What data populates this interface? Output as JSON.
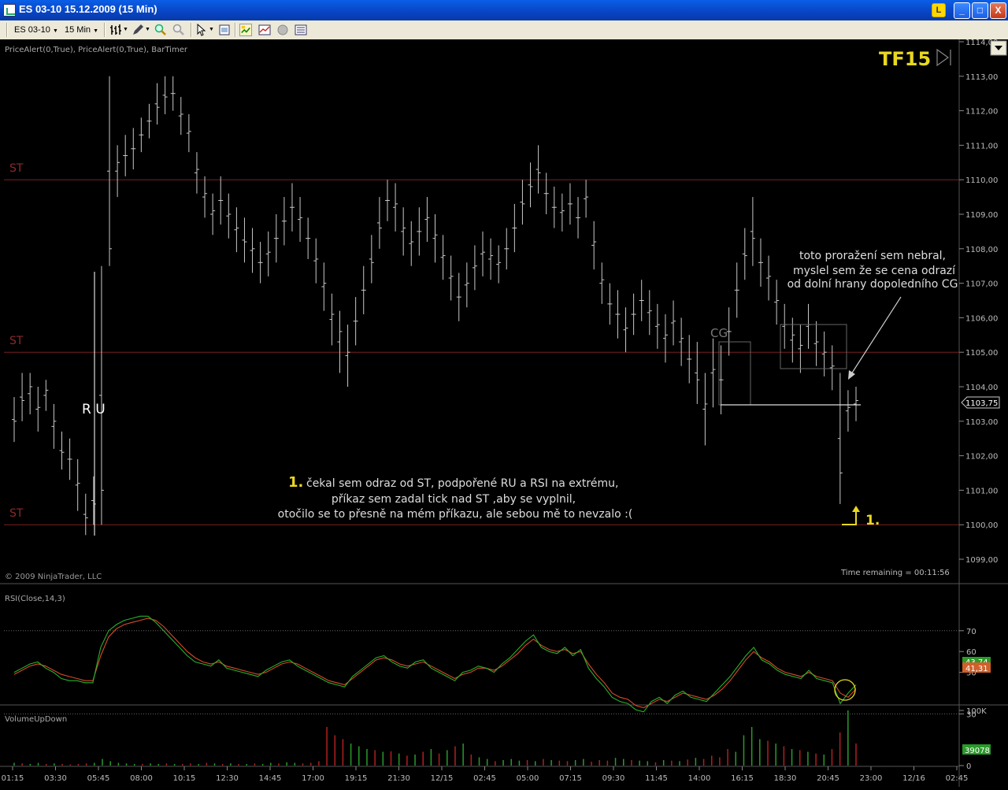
{
  "window": {
    "title": "ES 03-10  15.12.2009 (15 Min)",
    "l_badge": "L",
    "minimize": "_",
    "maximize": "□",
    "close": "X"
  },
  "toolbar": {
    "instrument": "ES 03-10",
    "interval": "15 Min"
  },
  "icons": [
    "chart-icon",
    "bars-icon",
    "pencil-icon",
    "zoom-in-icon",
    "zoom-out-icon",
    "cursor-icon",
    "properties-icon",
    "strategy-icon",
    "indicators-icon",
    "globe-icon",
    "data-box-icon"
  ],
  "colors": {
    "background": "#000000",
    "st_line": "#7a1f1f",
    "st_label": "#8b2a2a",
    "bars": "#c8c8c8",
    "annotation_yellow": "#e8d820",
    "rsi_red": "#d84a2a",
    "rsi_green": "#2ab02a",
    "vol_up": "#2a9a2a",
    "vol_down": "#b02020"
  },
  "price_panel": {
    "indicators_label": "PriceAlert(0,True), PriceAlert(0,True), BarTimer",
    "tf_label": "TF15",
    "copyright": "© 2009 NinjaTrader, LLC",
    "time_remaining": "Time remaining = 00:11:56",
    "current_price_label": "1103,75",
    "st_labels": [
      "ST",
      "ST",
      "ST"
    ],
    "ru_label": "R U",
    "cg_label": "CG",
    "note1_number": "1.",
    "note1_lines": [
      "čekal sem odraz od ST, podpořené RU a RSI na extrému,",
      "příkaz sem zadal tick nad ST ,aby se vyplnil,",
      "otočilo se to přesně na mém příkazu, ale sebou mě to nevzalo :("
    ],
    "note2_lines": [
      "toto proražení sem nebral,",
      "myslel sem že se cena odrazí",
      "od dolní hrany dopoledního CG"
    ],
    "marker_label": "1."
  },
  "rsi_panel": {
    "label": "RSI(Close,14,3)",
    "value_green": "43,74",
    "value_red": "41,31"
  },
  "volume_panel": {
    "label": "VolumeUpDown",
    "value": "39078"
  },
  "chart_data": [
    {
      "type": "ohlc",
      "title": "ES 03-10  15.12.2009 (15 Min)",
      "y_ticks": [
        "1099,00",
        "1100,00",
        "1101,00",
        "1102,00",
        "1103,00",
        "1104,00",
        "1105,00",
        "1106,00",
        "1107,00",
        "1108,00",
        "1109,00",
        "1110,00",
        "1111,00",
        "1112,00",
        "1113,00",
        "1114,00"
      ],
      "ylim": [
        1098.5,
        1114.0
      ],
      "st_levels": [
        1110.0,
        1105.0,
        1100.0
      ],
      "current_price": 1103.75,
      "x_ticks": [
        "01:15",
        "03:30",
        "05:45",
        "08:00",
        "10:15",
        "12:30",
        "14:45",
        "17:00",
        "19:15",
        "21:30",
        "12/15",
        "02:45",
        "05:00",
        "07:15",
        "09:30",
        "11:45",
        "14:00",
        "16:15",
        "18:30",
        "20:45",
        "23:00",
        "12/16",
        "02:45"
      ],
      "bars": [
        [
          1103,
          1103.7,
          1102.4
        ],
        [
          1103.6,
          1104.4,
          1103
        ],
        [
          1104,
          1104.4,
          1103.2
        ],
        [
          1103.4,
          1104,
          1102.7
        ],
        [
          1103.9,
          1104.2,
          1103.3
        ],
        [
          1103,
          1103.5,
          1102.2
        ],
        [
          1102.1,
          1102.7,
          1101.6
        ],
        [
          1101.9,
          1102.5,
          1101.3
        ],
        [
          1101.2,
          1101.9,
          1100.4
        ],
        [
          1100.2,
          1100.9,
          1099.7
        ],
        [
          1100.6,
          1101.4,
          1100
        ],
        [
          1101,
          1107.5,
          1100
        ],
        [
          1108,
          1113,
          1107.5
        ],
        [
          1110.5,
          1111,
          1109.5
        ],
        [
          1110.7,
          1111.3,
          1110.1
        ],
        [
          1110.9,
          1111.5,
          1110.3
        ],
        [
          1111.3,
          1111.8,
          1110.8
        ],
        [
          1111.7,
          1112.2,
          1111.2
        ],
        [
          1112.1,
          1112.8,
          1111.6
        ],
        [
          1112.4,
          1113,
          1111.9
        ],
        [
          1112.5,
          1113,
          1112
        ],
        [
          1111.9,
          1112.4,
          1111.3
        ],
        [
          1111.4,
          1111.9,
          1110.8
        ],
        [
          1110.3,
          1110.8,
          1109.6
        ],
        [
          1109.6,
          1110.1,
          1108.9
        ],
        [
          1109.1,
          1109.6,
          1108.4
        ],
        [
          1109.4,
          1110.1,
          1108.7
        ],
        [
          1109,
          1109.6,
          1108.3
        ],
        [
          1108.6,
          1109.2,
          1107.9
        ],
        [
          1108.2,
          1108.9,
          1107.6
        ],
        [
          1108,
          1108.6,
          1107.3
        ],
        [
          1107.6,
          1108.2,
          1107
        ],
        [
          1107.9,
          1108.5,
          1107.2
        ],
        [
          1108.3,
          1109,
          1107.6
        ],
        [
          1108.8,
          1109.5,
          1108.1
        ],
        [
          1109.2,
          1109.9,
          1108.5
        ],
        [
          1108.9,
          1109.5,
          1108.2
        ],
        [
          1108.3,
          1108.9,
          1107.7
        ],
        [
          1107.7,
          1108.3,
          1107
        ],
        [
          1107,
          1107.6,
          1106.2
        ],
        [
          1106.1,
          1106.7,
          1105.2
        ],
        [
          1105.6,
          1106.2,
          1104.4
        ],
        [
          1105,
          1105.8,
          1104
        ],
        [
          1105.9,
          1106.6,
          1105.2
        ],
        [
          1106.8,
          1107.5,
          1106.1
        ],
        [
          1107.6,
          1108.4,
          1107
        ],
        [
          1108.6,
          1109.5,
          1108
        ],
        [
          1109.4,
          1110,
          1108.8
        ],
        [
          1109.3,
          1109.9,
          1108.5
        ],
        [
          1108.6,
          1109.2,
          1107.8
        ],
        [
          1108.2,
          1108.8,
          1107.5
        ],
        [
          1108.5,
          1109.2,
          1107.8
        ],
        [
          1108.9,
          1109.5,
          1108.2
        ],
        [
          1108.4,
          1109,
          1107.6
        ],
        [
          1107.8,
          1108.4,
          1107.1
        ],
        [
          1107.2,
          1107.8,
          1106.5
        ],
        [
          1106.6,
          1107.3,
          1105.9
        ],
        [
          1107,
          1107.6,
          1106.3
        ],
        [
          1107.5,
          1108.1,
          1106.8
        ],
        [
          1107.9,
          1108.5,
          1107.2
        ],
        [
          1107.8,
          1108.3,
          1107.1
        ],
        [
          1107.6,
          1108.1,
          1107
        ],
        [
          1108,
          1108.6,
          1107.4
        ],
        [
          1108.6,
          1109.3,
          1107.9
        ],
        [
          1109.3,
          1110,
          1108.7
        ],
        [
          1109.8,
          1110.5,
          1109.2
        ],
        [
          1110.2,
          1111,
          1109.6
        ],
        [
          1109.6,
          1110.2,
          1109
        ],
        [
          1109.2,
          1109.8,
          1108.6
        ],
        [
          1109.1,
          1109.6,
          1108.5
        ],
        [
          1109.3,
          1109.9,
          1108.7
        ],
        [
          1108.9,
          1109.5,
          1108.3
        ],
        [
          1109.5,
          1110,
          1108.9
        ],
        [
          1108.2,
          1108.8,
          1107.4
        ],
        [
          1107.1,
          1107.6,
          1106.4
        ],
        [
          1106.4,
          1107,
          1105.8
        ],
        [
          1106.1,
          1106.8,
          1105.4
        ],
        [
          1105.7,
          1106.3,
          1105
        ],
        [
          1106.1,
          1106.7,
          1105.5
        ],
        [
          1106.5,
          1107.1,
          1105.9
        ],
        [
          1106.2,
          1106.8,
          1105.5
        ],
        [
          1105.8,
          1106.4,
          1105.1
        ],
        [
          1105.5,
          1106.1,
          1104.7
        ],
        [
          1105.9,
          1106.5,
          1105.2
        ],
        [
          1105.4,
          1106,
          1104.6
        ],
        [
          1104.8,
          1105.5,
          1104.1
        ],
        [
          1104.2,
          1105.3,
          1103.5
        ],
        [
          1103.5,
          1104.4,
          1102.3
        ],
        [
          1104.5,
          1105.4,
          1103.4
        ],
        [
          1104.2,
          1105.2,
          1103.2
        ],
        [
          1105.6,
          1106.3,
          1104.9
        ],
        [
          1106.8,
          1107.6,
          1106
        ],
        [
          1107.8,
          1108.6,
          1107.1
        ],
        [
          1108.3,
          1109.5,
          1107.5
        ],
        [
          1107.6,
          1108.3,
          1106.9
        ],
        [
          1107.2,
          1107.8,
          1106.5
        ],
        [
          1106.5,
          1107.1,
          1105.8
        ],
        [
          1105.8,
          1106.4,
          1105.1
        ],
        [
          1105.5,
          1106,
          1104.7
        ],
        [
          1105.2,
          1105.8,
          1104.4
        ],
        [
          1105.8,
          1106.4,
          1105.1
        ],
        [
          1105.3,
          1105.9,
          1104.6
        ],
        [
          1105,
          1105.6,
          1104.3
        ],
        [
          1104.6,
          1105.2,
          1103.9
        ],
        [
          1101.5,
          1104.4,
          1100.6
        ],
        [
          1103.4,
          1103.9,
          1102.7
        ],
        [
          1103.6,
          1104,
          1103
        ]
      ],
      "volume_ticks": [
        "100K",
        "0"
      ],
      "rsi_levels": [
        70,
        30
      ],
      "rsi_ticks": [
        "70",
        "60",
        "50",
        "30"
      ],
      "rsi_red": [
        49,
        51,
        53,
        54,
        53,
        51,
        49,
        48,
        47,
        46,
        46,
        58,
        67,
        71,
        73,
        74,
        75,
        76,
        75,
        72,
        68,
        64,
        60,
        57,
        55,
        54,
        55,
        53,
        52,
        51,
        50,
        49,
        50,
        52,
        54,
        55,
        54,
        52,
        50,
        48,
        46,
        45,
        44,
        47,
        50,
        53,
        56,
        57,
        56,
        54,
        53,
        54,
        55,
        53,
        51,
        49,
        47,
        49,
        50,
        52,
        52,
        51,
        53,
        56,
        59,
        63,
        66,
        63,
        61,
        60,
        61,
        59,
        60,
        54,
        49,
        45,
        40,
        38,
        37,
        34,
        33,
        35,
        37,
        36,
        38,
        40,
        39,
        38,
        37,
        39,
        42,
        46,
        51,
        56,
        60,
        57,
        55,
        52,
        50,
        49,
        48,
        50,
        48,
        47,
        46,
        40,
        38,
        42
      ],
      "rsi_green": [
        50,
        52,
        54,
        55,
        52,
        50,
        47,
        46,
        46,
        45,
        45,
        62,
        70,
        73,
        75,
        76,
        77,
        77,
        74,
        70,
        66,
        62,
        58,
        55,
        54,
        53,
        56,
        52,
        51,
        50,
        49,
        48,
        51,
        53,
        55,
        56,
        53,
        51,
        49,
        47,
        45,
        44,
        43,
        48,
        51,
        54,
        57,
        58,
        55,
        53,
        52,
        55,
        56,
        52,
        50,
        48,
        46,
        50,
        51,
        53,
        52,
        50,
        54,
        57,
        61,
        65,
        68,
        62,
        60,
        59,
        62,
        58,
        61,
        52,
        47,
        43,
        38,
        36,
        35,
        32,
        31,
        36,
        38,
        35,
        39,
        41,
        38,
        37,
        36,
        40,
        44,
        48,
        53,
        58,
        62,
        56,
        54,
        51,
        49,
        48,
        47,
        51,
        47,
        46,
        45,
        35,
        40,
        44
      ],
      "volume": [
        [
          5,
          "u"
        ],
        [
          4,
          "d"
        ],
        [
          3,
          "u"
        ],
        [
          5,
          "u"
        ],
        [
          3,
          "d"
        ],
        [
          4,
          "u"
        ],
        [
          3,
          "d"
        ],
        [
          2,
          "d"
        ],
        [
          3,
          "d"
        ],
        [
          4,
          "d"
        ],
        [
          5,
          "u"
        ],
        [
          12,
          "u"
        ],
        [
          8,
          "u"
        ],
        [
          5,
          "u"
        ],
        [
          4,
          "u"
        ],
        [
          3,
          "u"
        ],
        [
          3,
          "d"
        ],
        [
          4,
          "u"
        ],
        [
          3,
          "u"
        ],
        [
          4,
          "d"
        ],
        [
          3,
          "u"
        ],
        [
          3,
          "d"
        ],
        [
          4,
          "d"
        ],
        [
          3,
          "u"
        ],
        [
          5,
          "d"
        ],
        [
          4,
          "u"
        ],
        [
          3,
          "d"
        ],
        [
          4,
          "u"
        ],
        [
          3,
          "d"
        ],
        [
          3,
          "u"
        ],
        [
          4,
          "d"
        ],
        [
          3,
          "u"
        ],
        [
          5,
          "u"
        ],
        [
          4,
          "d"
        ],
        [
          6,
          "u"
        ],
        [
          5,
          "u"
        ],
        [
          4,
          "d"
        ],
        [
          5,
          "d"
        ],
        [
          8,
          "d"
        ],
        [
          70,
          "d"
        ],
        [
          55,
          "d"
        ],
        [
          48,
          "d"
        ],
        [
          40,
          "u"
        ],
        [
          35,
          "u"
        ],
        [
          30,
          "u"
        ],
        [
          28,
          "d"
        ],
        [
          25,
          "u"
        ],
        [
          26,
          "d"
        ],
        [
          22,
          "u"
        ],
        [
          18,
          "d"
        ],
        [
          20,
          "u"
        ],
        [
          25,
          "d"
        ],
        [
          30,
          "u"
        ],
        [
          22,
          "d"
        ],
        [
          28,
          "u"
        ],
        [
          35,
          "d"
        ],
        [
          40,
          "u"
        ],
        [
          20,
          "d"
        ],
        [
          15,
          "u"
        ],
        [
          12,
          "u"
        ],
        [
          8,
          "d"
        ],
        [
          10,
          "u"
        ],
        [
          12,
          "u"
        ],
        [
          9,
          "u"
        ],
        [
          10,
          "d"
        ],
        [
          8,
          "u"
        ],
        [
          12,
          "d"
        ],
        [
          10,
          "u"
        ],
        [
          9,
          "d"
        ],
        [
          8,
          "d"
        ],
        [
          10,
          "u"
        ],
        [
          12,
          "u"
        ],
        [
          7,
          "d"
        ],
        [
          10,
          "d"
        ],
        [
          9,
          "d"
        ],
        [
          14,
          "u"
        ],
        [
          12,
          "u"
        ],
        [
          10,
          "d"
        ],
        [
          9,
          "u"
        ],
        [
          8,
          "u"
        ],
        [
          6,
          "d"
        ],
        [
          10,
          "u"
        ],
        [
          9,
          "d"
        ],
        [
          8,
          "u"
        ],
        [
          11,
          "d"
        ],
        [
          14,
          "u"
        ],
        [
          12,
          "d"
        ],
        [
          18,
          "d"
        ],
        [
          15,
          "d"
        ],
        [
          30,
          "d"
        ],
        [
          25,
          "u"
        ],
        [
          55,
          "u"
        ],
        [
          70,
          "u"
        ],
        [
          48,
          "u"
        ],
        [
          45,
          "d"
        ],
        [
          40,
          "u"
        ],
        [
          35,
          "d"
        ],
        [
          30,
          "u"
        ],
        [
          28,
          "d"
        ],
        [
          25,
          "u"
        ],
        [
          22,
          "d"
        ],
        [
          20,
          "u"
        ],
        [
          30,
          "d"
        ],
        [
          60,
          "d"
        ],
        [
          100,
          "u"
        ],
        [
          40,
          "d"
        ]
      ]
    }
  ]
}
